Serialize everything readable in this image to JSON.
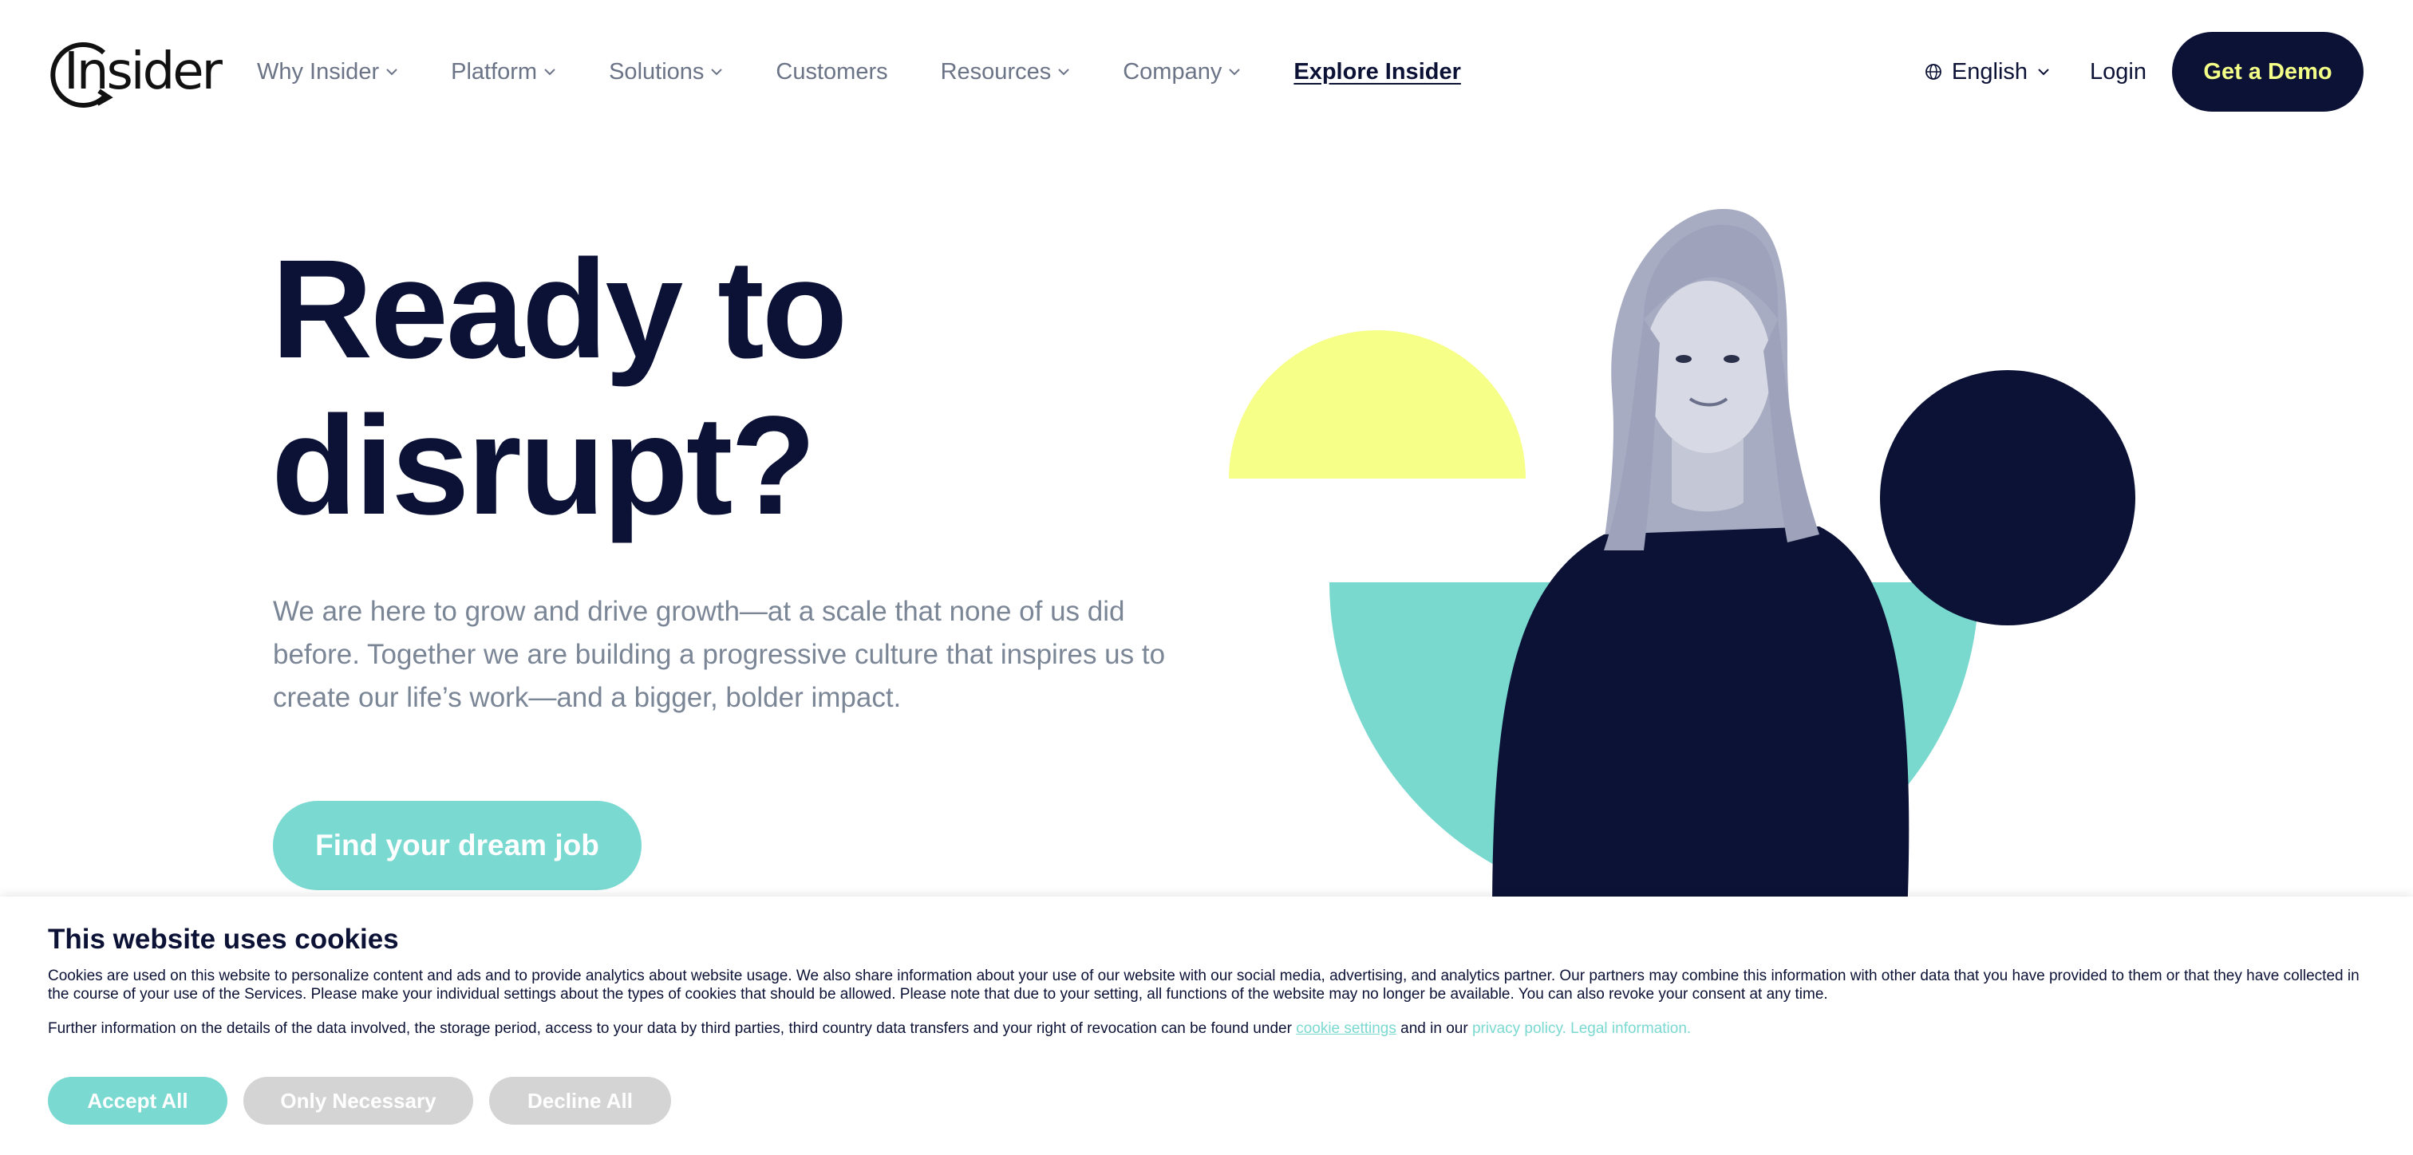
{
  "brand": {
    "logo_text": "Insider"
  },
  "nav": {
    "items": [
      {
        "label": "Why Insider",
        "dropdown": true
      },
      {
        "label": "Platform",
        "dropdown": true
      },
      {
        "label": "Solutions",
        "dropdown": true
      },
      {
        "label": "Customers",
        "dropdown": false
      },
      {
        "label": "Resources",
        "dropdown": true
      },
      {
        "label": "Company",
        "dropdown": true
      }
    ],
    "explore": "Explore Insider",
    "language": "English",
    "login": "Login",
    "demo": "Get a Demo"
  },
  "hero": {
    "title_line1": "Ready to",
    "title_line2": "disrupt?",
    "description": "We are here to grow and drive growth—at a scale that none of us did before. Together we are building a progressive culture that inspires us to create our life’s work—and a bigger, bolder impact.",
    "cta": "Find your dream job"
  },
  "cookies": {
    "title": "This website uses cookies",
    "body": "Cookies are used on this website to personalize content and ads and to provide analytics about website usage. We also share information about your use of our website with our social media, advertising, and analytics partner. Our partners may combine this information with other data that you have provided to them or that they have collected in the course of your use of the Services. Please make your individual settings about the types of cookies that should be allowed. Please note that due to your setting, all functions of the website may no longer be available. You can also revoke your consent at any time.",
    "further_prefix": "Further information on the details of the data involved, the storage period, access to your data by third parties, third country data transfers and your right of revocation can be found under",
    "cookie_settings_link": "cookie settings",
    "and_in_our": "and in our",
    "privacy_link": "privacy policy.",
    "legal_link": "Legal information.",
    "accept": "Accept All",
    "necessary": "Only Necessary",
    "decline": "Decline All"
  },
  "colors": {
    "navy": "#0c1236",
    "teal": "#7ad9d0",
    "yellow": "#f4ff87",
    "muted": "#7a8596"
  },
  "icons": [
    "chevron-down-icon",
    "globe-icon",
    "logo-arc-icon"
  ]
}
